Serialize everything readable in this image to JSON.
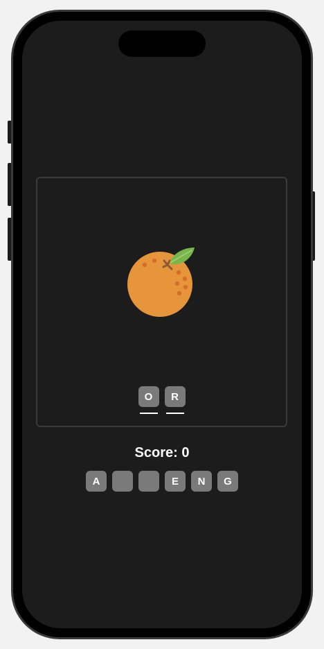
{
  "game": {
    "fruit_icon": "orange-icon",
    "answer_letters": [
      "O",
      "R"
    ],
    "score_text": "Score: 0",
    "letter_tiles": [
      "A",
      "",
      "",
      "E",
      "N",
      "G"
    ]
  },
  "colors": {
    "screen_background": "#1c1c1c",
    "tile_background": "#7a7a7a",
    "orange": "#e6953a",
    "leaf": "#78b54a"
  }
}
